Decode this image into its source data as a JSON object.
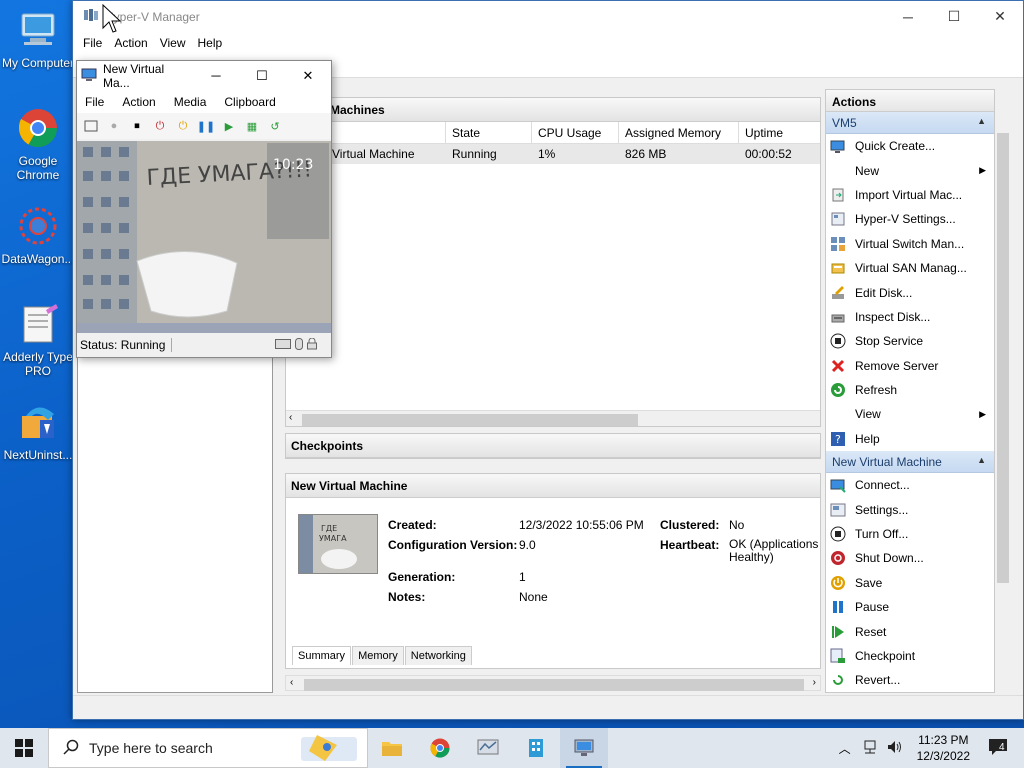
{
  "desktop": {
    "icons": [
      {
        "label": "My Computer",
        "icon": "computer-icon"
      },
      {
        "label": "Google Chrome",
        "icon": "chrome-icon"
      },
      {
        "label": "DataWagon...",
        "icon": "datawagon-icon"
      },
      {
        "label": "Adderly Type PRO",
        "icon": "notepad-icon"
      },
      {
        "label": "NextUninst...",
        "icon": "uninstaller-icon"
      }
    ]
  },
  "hyperv": {
    "title": "Hyper-V Manager",
    "menu": [
      "File",
      "Action",
      "View",
      "Help"
    ],
    "vms_header": "Machines",
    "columns": [
      "State",
      "CPU Usage",
      "Assigned Memory",
      "Uptime"
    ],
    "rows": [
      {
        "name": "Virtual Machine",
        "state": "Running",
        "cpu": "1%",
        "memory": "826 MB",
        "uptime": "00:00:52"
      }
    ],
    "checkpoints_header": "Checkpoints",
    "details_header": "New Virtual Machine",
    "details": {
      "created_label": "Created:",
      "created_value": "12/3/2022 10:55:06 PM",
      "config_label": "Configuration Version:",
      "config_value": "9.0",
      "generation_label": "Generation:",
      "generation_value": "1",
      "notes_label": "Notes:",
      "notes_value": "None",
      "clustered_label": "Clustered:",
      "clustered_value": "No",
      "heartbeat_label": "Heartbeat:",
      "heartbeat_value": "OK (Applications Healthy)"
    },
    "tabs": [
      "Summary",
      "Memory",
      "Networking"
    ],
    "actions": {
      "title": "Actions",
      "group1": "VM5",
      "group1_items": [
        {
          "label": "Quick Create...",
          "icon": "quick-create-icon",
          "sub": false
        },
        {
          "label": "New",
          "icon": "",
          "sub": true
        },
        {
          "label": "Import Virtual Mac...",
          "icon": "import-icon",
          "sub": false
        },
        {
          "label": "Hyper-V Settings...",
          "icon": "settings-icon",
          "sub": false
        },
        {
          "label": "Virtual Switch Man...",
          "icon": "switch-icon",
          "sub": false
        },
        {
          "label": "Virtual SAN Manag...",
          "icon": "san-icon",
          "sub": false
        },
        {
          "label": "Edit Disk...",
          "icon": "edit-disk-icon",
          "sub": false
        },
        {
          "label": "Inspect Disk...",
          "icon": "inspect-disk-icon",
          "sub": false
        },
        {
          "label": "Stop Service",
          "icon": "stop-icon",
          "sub": false
        },
        {
          "label": "Remove Server",
          "icon": "remove-icon",
          "sub": false
        },
        {
          "label": "Refresh",
          "icon": "refresh-icon",
          "sub": false
        },
        {
          "label": "View",
          "icon": "",
          "sub": true
        },
        {
          "label": "Help",
          "icon": "help-icon",
          "sub": false
        }
      ],
      "group2": "New Virtual Machine",
      "group2_items": [
        {
          "label": "Connect...",
          "icon": "connect-icon"
        },
        {
          "label": "Settings...",
          "icon": "vm-settings-icon"
        },
        {
          "label": "Turn Off...",
          "icon": "turn-off-icon"
        },
        {
          "label": "Shut Down...",
          "icon": "shutdown-icon"
        },
        {
          "label": "Save",
          "icon": "save-icon"
        },
        {
          "label": "Pause",
          "icon": "pause-icon"
        },
        {
          "label": "Reset",
          "icon": "reset-icon"
        },
        {
          "label": "Checkpoint",
          "icon": "checkpoint-icon"
        },
        {
          "label": "Revert...",
          "icon": "revert-icon"
        }
      ]
    }
  },
  "vmconnect": {
    "title": "New Virtual Ma...",
    "menu": [
      "File",
      "Action",
      "Media",
      "Clipboard"
    ],
    "screen_clock": "10:23",
    "screen_text": "ГДЕ УМАГА?!!!",
    "status": "Status: Running"
  },
  "taskbar": {
    "search_placeholder": "Type here to search",
    "time": "11:23 PM",
    "date": "12/3/2022",
    "notifications": "4"
  }
}
